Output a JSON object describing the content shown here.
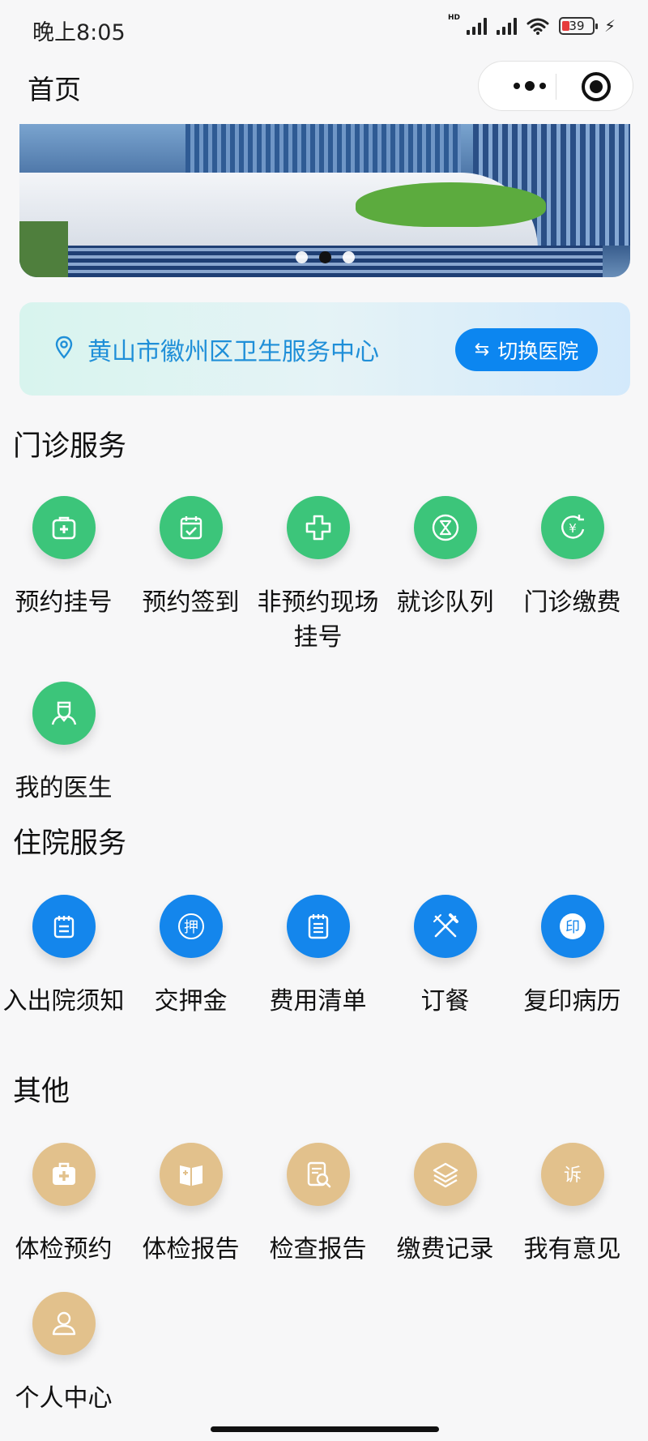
{
  "status_bar": {
    "time": "晚上8:05",
    "battery": "39"
  },
  "nav": {
    "title": "首页"
  },
  "banner": {
    "active_index": 1,
    "slide_count": 3
  },
  "hospital": {
    "name": "黄山市徽州区卫生服务中心",
    "switch_label": "切换医院"
  },
  "sections": {
    "outpatient": {
      "title": "门诊服务",
      "items": [
        {
          "label": "预约挂号",
          "icon": "medical-kit-icon"
        },
        {
          "label": "预约签到",
          "icon": "calendar-check-icon"
        },
        {
          "label": "非预约现场挂号",
          "icon": "medical-cross-icon"
        },
        {
          "label": "就诊队列",
          "icon": "hourglass-icon"
        },
        {
          "label": "门诊缴费",
          "icon": "yuan-refresh-icon"
        },
        {
          "label": "我的医生",
          "icon": "doctor-icon"
        }
      ]
    },
    "inpatient": {
      "title": "住院服务",
      "items": [
        {
          "label": "入出院须知",
          "icon": "notepad-icon"
        },
        {
          "label": "交押金",
          "icon": "deposit-seal-icon"
        },
        {
          "label": "费用清单",
          "icon": "list-icon"
        },
        {
          "label": "订餐",
          "icon": "fork-knife-icon"
        },
        {
          "label": "复印病历",
          "icon": "stamp-icon"
        }
      ]
    },
    "other": {
      "title": "其他",
      "items": [
        {
          "label": "体检预约",
          "icon": "medical-kit-icon"
        },
        {
          "label": "体检报告",
          "icon": "book-icon"
        },
        {
          "label": "检查报告",
          "icon": "report-search-icon"
        },
        {
          "label": "缴费记录",
          "icon": "stack-icon"
        },
        {
          "label": "我有意见",
          "icon": "complaint-icon"
        },
        {
          "label": "个人中心",
          "icon": "user-icon"
        }
      ]
    }
  },
  "colors": {
    "green": "#3cc57a",
    "blue": "#1486ec",
    "gold": "#e2c18c",
    "accent": "#0c86f0"
  }
}
